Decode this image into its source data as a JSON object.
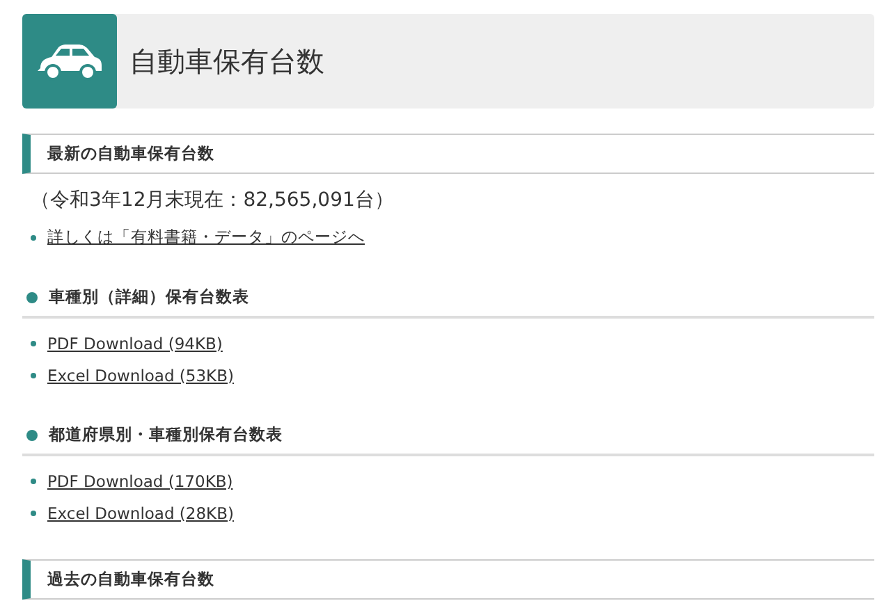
{
  "page_title": "自動車保有台数",
  "blocks": [
    {
      "kind": "section",
      "text": "最新の自動車保有台数"
    },
    {
      "kind": "note",
      "text": "（令和3年12月末現在：82,565,091台）"
    },
    {
      "kind": "links",
      "items": [
        "詳しくは「有料書籍・データ」のページへ"
      ]
    },
    {
      "kind": "subheading",
      "text": "車種別（詳細）保有台数表"
    },
    {
      "kind": "links",
      "items": [
        "PDF Download (94KB)",
        "Excel Download (53KB)"
      ]
    },
    {
      "kind": "subheading",
      "text": "都道府県別・車種別保有台数表"
    },
    {
      "kind": "links",
      "items": [
        "PDF Download (170KB)",
        "Excel Download (28KB)"
      ]
    },
    {
      "kind": "section",
      "text": "過去の自動車保有台数"
    }
  ]
}
